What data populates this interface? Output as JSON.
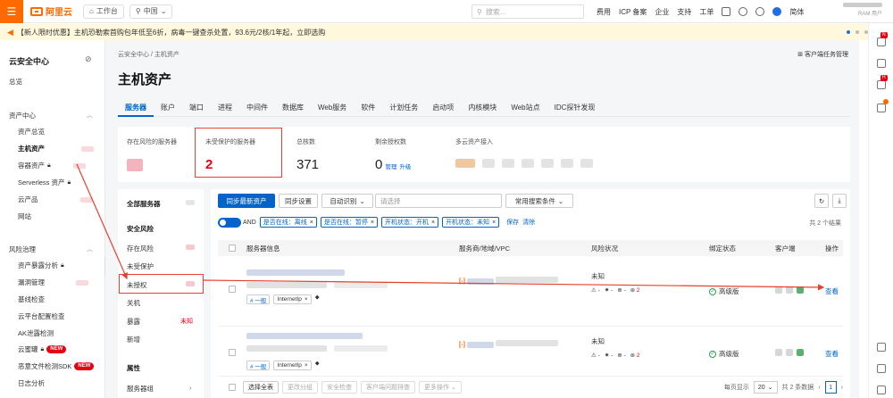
{
  "topbar": {
    "menu_glyph": "☰",
    "brand": "阿里云",
    "workbench": "工作台",
    "region": "中国",
    "search_placeholder": "搜索...",
    "links": [
      "费用",
      "ICP 备案",
      "企业",
      "支持",
      "工单"
    ],
    "lang": "简体",
    "user_role": "RAM 用户"
  },
  "banner": {
    "text": "【新人限时优惠】主机恐勒索首购包年低至6折，病毒一键查杀处置，93.6元/2核/1年起，立即选购"
  },
  "sidebar": {
    "title": "云安全中心",
    "overview": "总览",
    "groups": [
      {
        "label": "资产中心",
        "items": [
          "资产总览",
          "主机资产",
          "容器资产",
          "Serverless 资产",
          "云产品",
          "网站"
        ]
      },
      {
        "label": "风险治理",
        "items": [
          "资产暴露分析",
          "漏洞管理",
          "基线检查",
          "云平台配置检查",
          "AK泄露检测",
          "云蜜罐",
          "恶意文件检测SDK",
          "日志分析"
        ]
      }
    ],
    "new_badge": "NEW"
  },
  "main": {
    "breadcrumb": "云安全中心  /  主机资产",
    "guide": "客户端任务管理",
    "title": "主机资产",
    "tabs": [
      "服务器",
      "账户",
      "端口",
      "进程",
      "中间件",
      "数据库",
      "Web服务",
      "软件",
      "计划任务",
      "启动项",
      "内核模块",
      "Web站点",
      "IDC探针发现"
    ],
    "stats": {
      "risk_label": "存在风险的服务器",
      "unprotected_label": "未受保护的服务器",
      "unprotected_value": "2",
      "total_label": "总核数",
      "total_value": "371",
      "license_label": "剩余授权数",
      "license_value": "0",
      "manage": "管理",
      "upgrade": "升级",
      "multicloud_label": "多云资产接入"
    }
  },
  "leftpanel": {
    "all": "全部服务器",
    "risk_section": "安全风险",
    "items": [
      "存在风险",
      "未受保护",
      "未授权",
      "关机",
      "暴露",
      "新增"
    ],
    "expose_tag": "未知",
    "attr_section": "属性",
    "group": "服务器组"
  },
  "toolbar": {
    "sync_latest": "同步最新资产",
    "sync_settings": "同步设置",
    "auto_identify": "自动识别",
    "select_placeholder": "请选择",
    "common_search": "常用搜索条件",
    "refresh_glyph": "↻",
    "download_glyph": "⤓"
  },
  "filters": {
    "toggle": "AND",
    "chips": [
      "是否在线：离线",
      "是否在线：暂停",
      "开机状态：开机",
      "开机状态：未知"
    ],
    "save": "保存",
    "clear": "清除",
    "count": "共 2 个结果"
  },
  "table": {
    "headers": [
      "服务器信息",
      "服务商/地域/VPC",
      "风险状况",
      "绑定状态",
      "客户端",
      "操作"
    ],
    "rows": [
      {
        "tag": "# 一般",
        "ip": "InternetIp",
        "risk": "未知",
        "vuln": "2",
        "bind": "高级版",
        "op": "查看"
      },
      {
        "tag": "# 一般",
        "ip": "InternetIp",
        "risk": "未知",
        "vuln": "2",
        "bind": "高级版",
        "op": "查看"
      }
    ]
  },
  "footer": {
    "select_all": "选择全表",
    "change_group": "更改分组",
    "security_check": "安全检查",
    "client_troubleshoot": "客户端问题排查",
    "more": "更多操作",
    "per_page_label": "每页显示",
    "per_page": "20",
    "total": "共 2 条数据",
    "page": "1"
  }
}
